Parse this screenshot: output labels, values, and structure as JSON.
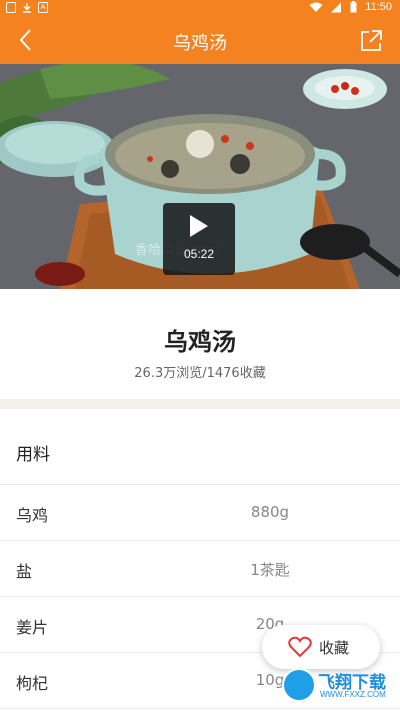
{
  "status_bar": {
    "time": "11:50",
    "icons": [
      "image-icon",
      "download-icon",
      "app-a-icon",
      "wifi-icon",
      "signal-icon",
      "battery-icon"
    ],
    "app_icon_letter": "A"
  },
  "header": {
    "title": "乌鸡汤",
    "background_color": "#f58220",
    "back_icon": "chevron-left-icon",
    "share_icon": "share-icon"
  },
  "video": {
    "duration": "05:22",
    "watermark": "香哈菜谱.com",
    "play_icon": "play-icon"
  },
  "recipe": {
    "title": "乌鸡汤",
    "stats": "26.3万浏览/1476收藏"
  },
  "ingredients": {
    "section_title": "用料",
    "items": [
      {
        "name": "乌鸡",
        "amount": "880g"
      },
      {
        "name": "盐",
        "amount": "1茶匙"
      },
      {
        "name": "姜片",
        "amount": "20g"
      },
      {
        "name": "枸杞",
        "amount": "10g"
      }
    ]
  },
  "favorite": {
    "label": "收藏",
    "icon": "heart-icon",
    "color": "#e03a3a"
  },
  "site_watermark": {
    "brand": "飞翔下载",
    "url": "WWW.FXXZ.COM"
  }
}
